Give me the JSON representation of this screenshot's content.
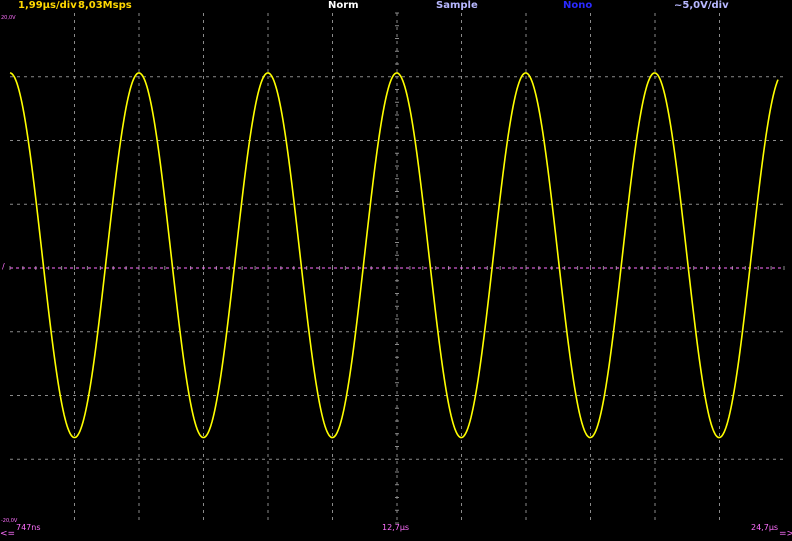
{
  "header": {
    "timebase": "1,99µs/div",
    "sample_rate": "8,03Msps",
    "trigger_mode": "Norm",
    "acquisition_mode": "Sample",
    "channel2_mode": "Nono",
    "volts_per_div": "~5,0V/div"
  },
  "footer": {
    "time_start": "747ns",
    "time_center": "12,7µs",
    "time_end": "24,7µs",
    "scroll_left": "<=",
    "scroll_right": "=>"
  },
  "scale": {
    "top": "20,0V",
    "bottom": "-20,0V"
  },
  "colors": {
    "trace": "#ffff00",
    "grid": "#8a8a8a",
    "ground_line": "#ff70ff"
  },
  "waveform": {
    "type": "sine",
    "time_start_us": 0.747,
    "time_end_us": 24.7,
    "amplitude_v": 14.3,
    "offset_v": 1.0,
    "period_us": 3.99,
    "phase_time_us": 0.747
  }
}
